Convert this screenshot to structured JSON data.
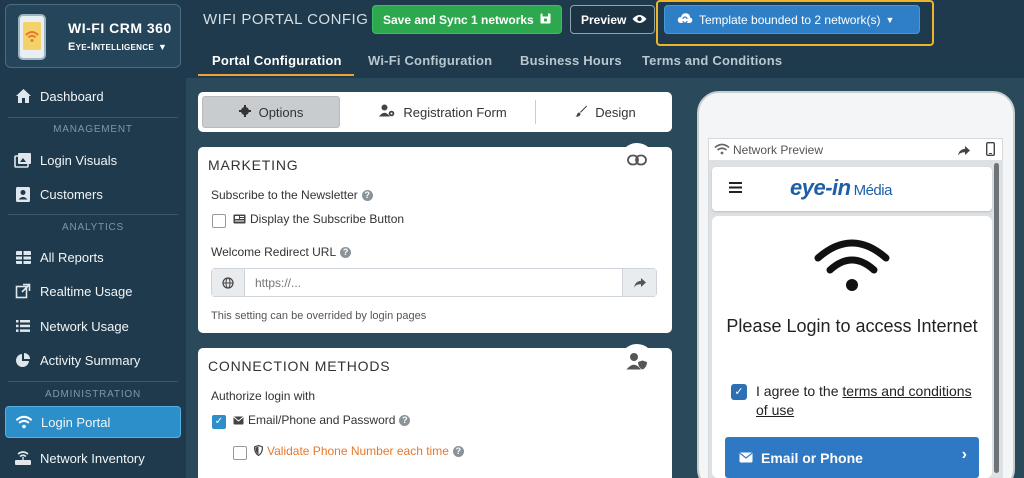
{
  "brand": {
    "title": "WI-FI CRM 360",
    "subtitle": "Eye-Intelligence"
  },
  "sidebar": {
    "items": [
      {
        "label": "Dashboard"
      },
      {
        "label": "Login Visuals"
      },
      {
        "label": "Customers"
      },
      {
        "label": "All Reports"
      },
      {
        "label": "Realtime Usage"
      },
      {
        "label": "Network Usage"
      },
      {
        "label": "Activity Summary"
      },
      {
        "label": "Login Portal"
      },
      {
        "label": "Network Inventory"
      }
    ],
    "sections": {
      "management": "MANAGEMENT",
      "analytics": "ANALYTICS",
      "administration": "ADMINISTRATION"
    }
  },
  "header": {
    "title": "WIFI PORTAL CONFIG",
    "sync_label": "Save and Sync 1 networks",
    "preview_label": "Preview",
    "template_label": "Template bounded to 2 network(s)"
  },
  "tabs": [
    "Portal Configuration",
    "Wi-Fi Configuration",
    "Business Hours",
    "Terms and Conditions"
  ],
  "segments": {
    "options": "Options",
    "registration": "Registration Form",
    "design": "Design"
  },
  "marketing": {
    "heading": "MARKETING",
    "newsletter_label": "Subscribe to the Newsletter",
    "subscribe_button_label": "Display the Subscribe Button",
    "redirect_label": "Welcome Redirect URL",
    "redirect_placeholder": "https://...",
    "hint": "This setting can be overrided by login pages"
  },
  "connection": {
    "heading": "CONNECTION METHODS",
    "authorize_label": "Authorize login with",
    "email_phone_label": "Email/Phone and Password",
    "validate_phone_label": "Validate Phone Number each time"
  },
  "preview": {
    "bar_title": "Network Preview",
    "logo_main": "eye-in",
    "logo_sub": "Média",
    "login_title": "Please Login to access Internet",
    "agree_prefix": "I agree to the ",
    "agree_link": "terms and conditions of use",
    "email_button": "Email or Phone"
  },
  "colors": {
    "sidebar_bg": "#1f3a4c",
    "active_nav": "#2d8fc9",
    "sync_green": "#2ea84f",
    "template_blue": "#2f7fc6",
    "highlight": "#f0b429",
    "orange_text": "#e8782a"
  }
}
